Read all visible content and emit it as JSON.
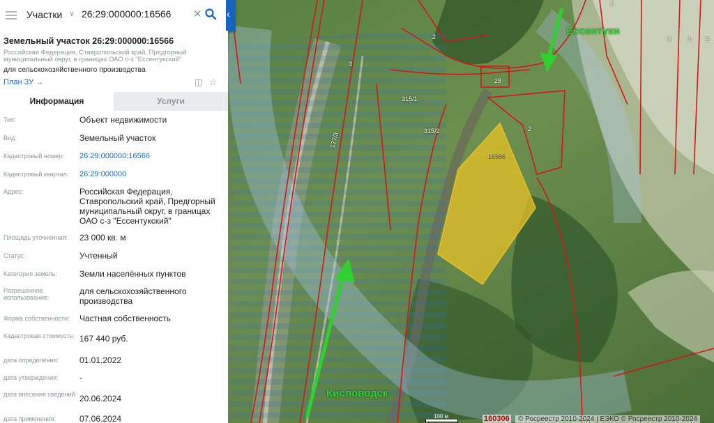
{
  "search": {
    "type_label": "Участки",
    "query": "26:29:000000:16566"
  },
  "panel": {
    "title": "Земельный участок 26:29:000000:16566",
    "address_short": "Российская Федерация, Ставропольский край, Предгорный муниципальный округ, в границах ОАО с-з \"Ессентукский\"",
    "purpose": "для сельскохозяйственного производства",
    "plan_link": "План ЗУ",
    "tabs": [
      {
        "label": "Информация",
        "active": true
      },
      {
        "label": "Услуги",
        "active": false
      }
    ],
    "fields": [
      {
        "label": "Тип:",
        "value": "Объект недвижимости"
      },
      {
        "label": "Вид:",
        "value": "Земельный участок"
      },
      {
        "label": "Кадастровый номер:",
        "value": "26:29:000000:16566"
      },
      {
        "label": "Кадастровый квартал:",
        "value": "26:29:000000"
      },
      {
        "label": "Адрес:",
        "value": "Российская Федерация, Ставропольский край, Предгорный муниципальный округ, в границах ОАО с-з \"Ессентукский\""
      },
      {
        "label": "Площадь уточненная:",
        "value": "23 000 кв. м"
      },
      {
        "label": "Статус:",
        "value": "Учтенный"
      },
      {
        "label": "Категория земель:",
        "value": "Земли населённых пунктов"
      },
      {
        "label": "Разрешенное использование:",
        "value": "для сельскохозяйственного производства"
      },
      {
        "label": "Форма собственности:",
        "value": "Частная собственность"
      },
      {
        "label": "Кадастровая стоимость:",
        "value": "167 440 руб."
      },
      {
        "label": "дата определения:",
        "value": "01.01.2022"
      },
      {
        "label": "дата утверждения:",
        "value": "-"
      },
      {
        "label": "дата внесения сведений:",
        "value": "20.06.2024"
      },
      {
        "label": "дата применения:",
        "value": "07.06.2024"
      }
    ]
  },
  "map": {
    "label_top": "Ессентуки",
    "label_bottom": "Кисловодск",
    "plot_labels": [
      "16566",
      "315/1",
      "315/2",
      "28",
      "2",
      "2",
      "3",
      "4",
      "5",
      "1",
      "127/3",
      "3"
    ],
    "scale": "100 м",
    "cad_number": "160306",
    "copyright": "© Росреестр 2010-2024 | ЕЭКО © Росреестр 2010-2024"
  },
  "colors": {
    "accent": "#1565c0",
    "boundary": "#d01818",
    "plot_fill": "#e8c227",
    "arrow": "#2fd12f"
  }
}
